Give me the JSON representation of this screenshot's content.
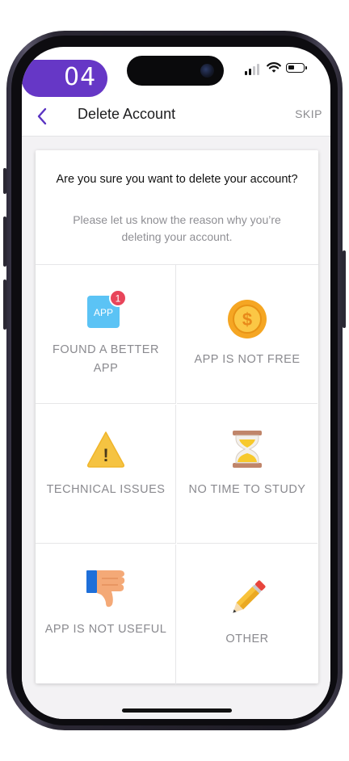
{
  "status_bar": {
    "step_badge": "04"
  },
  "header": {
    "title": "Delete Account",
    "skip_label": "SKIP",
    "back_icon": "chevron-left-icon"
  },
  "prompt": {
    "question": "Are you sure you want to delete your account?",
    "subtext": "Please let us know the reason why you’re deleting your account."
  },
  "reasons": [
    {
      "label": "FOUND A BETTER APP",
      "icon": "app-badge-icon",
      "icon_text": "APP",
      "badge_count": "1"
    },
    {
      "label": "APP IS NOT FREE",
      "icon": "dollar-coin-icon",
      "icon_text": "$"
    },
    {
      "label": "TECHNICAL ISSUES",
      "icon": "warning-icon",
      "icon_text": "!"
    },
    {
      "label": "NO TIME TO STUDY",
      "icon": "hourglass-icon"
    },
    {
      "label": "APP IS NOT USEFUL",
      "icon": "thumbs-down-icon"
    },
    {
      "label": "OTHER",
      "icon": "pencil-icon"
    }
  ],
  "colors": {
    "accent": "#6637c6",
    "label_gray": "#8a8a8f",
    "app_icon": "#5bc3f5",
    "badge": "#e8455a",
    "coin": "#f5a623",
    "warning": "#f5c342",
    "thumb": "#f4a977"
  }
}
